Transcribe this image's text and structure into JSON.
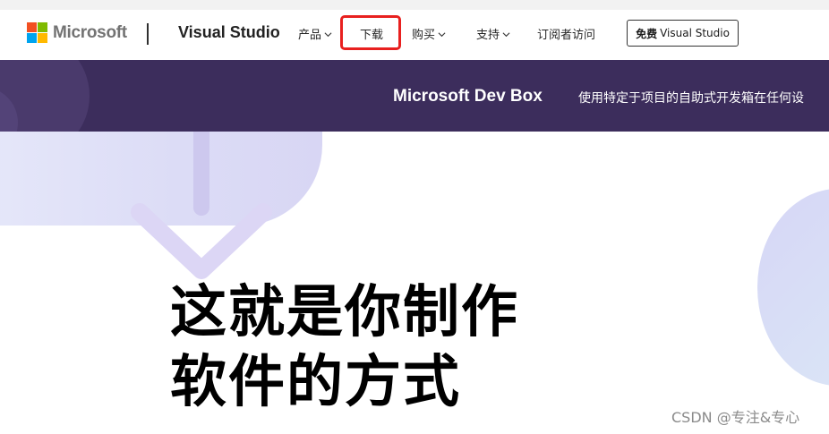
{
  "header": {
    "brand": "Microsoft",
    "product": "Visual Studio",
    "nav": {
      "products": "产品",
      "download": "下载",
      "buy": "购买",
      "support": "支持",
      "subscribers": "订阅者访问"
    },
    "free_button": {
      "bold": "免费",
      "rest": "Visual Studio"
    }
  },
  "banner": {
    "title": "Microsoft Dev Box",
    "text": "使用特定于项目的自助式开发箱在任何设"
  },
  "hero": {
    "line1": "这就是你制作",
    "line2": "软件的方式"
  },
  "watermark": "CSDN @专注&专心",
  "colors": {
    "banner_bg": "#3c2d5c",
    "highlight": "#e8201f",
    "logo": [
      "#f25022",
      "#7fba00",
      "#00a4ef",
      "#ffb900"
    ]
  },
  "icons": {
    "chevron": "chevron-down-icon",
    "logo": "microsoft-logo",
    "decor": "down-arrow-icon"
  }
}
